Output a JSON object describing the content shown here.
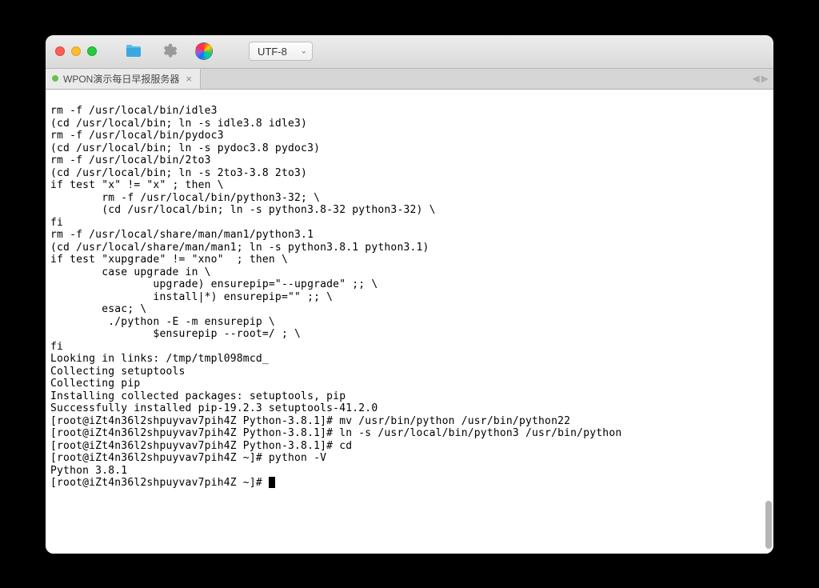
{
  "window": {
    "encoding_label": "UTF-8"
  },
  "tab": {
    "title": "WPON演示每日早报服务器"
  },
  "terminal": {
    "lines": [
      "rm -f /usr/local/bin/idle3",
      "(cd /usr/local/bin; ln -s idle3.8 idle3)",
      "rm -f /usr/local/bin/pydoc3",
      "(cd /usr/local/bin; ln -s pydoc3.8 pydoc3)",
      "rm -f /usr/local/bin/2to3",
      "(cd /usr/local/bin; ln -s 2to3-3.8 2to3)",
      "if test \"x\" != \"x\" ; then \\",
      "        rm -f /usr/local/bin/python3-32; \\",
      "        (cd /usr/local/bin; ln -s python3.8-32 python3-32) \\",
      "fi",
      "rm -f /usr/local/share/man/man1/python3.1",
      "(cd /usr/local/share/man/man1; ln -s python3.8.1 python3.1)",
      "if test \"xupgrade\" != \"xno\"  ; then \\",
      "        case upgrade in \\",
      "                upgrade) ensurepip=\"--upgrade\" ;; \\",
      "                install|*) ensurepip=\"\" ;; \\",
      "        esac; \\",
      "         ./python -E -m ensurepip \\",
      "                $ensurepip --root=/ ; \\",
      "fi",
      "Looking in links: /tmp/tmpl098mcd_",
      "Collecting setuptools",
      "Collecting pip",
      "Installing collected packages: setuptools, pip",
      "Successfully installed pip-19.2.3 setuptools-41.2.0",
      "[root@iZt4n36l2shpuyvav7pih4Z Python-3.8.1]# mv /usr/bin/python /usr/bin/python22",
      "[root@iZt4n36l2shpuyvav7pih4Z Python-3.8.1]# ln -s /usr/local/bin/python3 /usr/bin/python",
      "[root@iZt4n36l2shpuyvav7pih4Z Python-3.8.1]# cd",
      "[root@iZt4n36l2shpuyvav7pih4Z ~]# python -V",
      "Python 3.8.1"
    ],
    "prompt": "[root@iZt4n36l2shpuyvav7pih4Z ~]# "
  }
}
